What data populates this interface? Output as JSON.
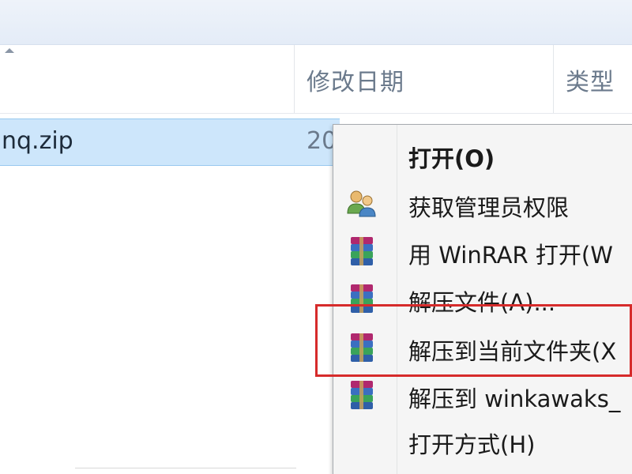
{
  "columns": {
    "date_modified": "修改日期",
    "type": "类型"
  },
  "file": {
    "name": "nq.zip",
    "date_partial": "20"
  },
  "context_menu": {
    "items": [
      {
        "label": "打开(O)",
        "icon": "",
        "bold": true
      },
      {
        "label": "获取管理员权限",
        "icon": "admin-users-icon",
        "bold": false
      },
      {
        "label": "用 WinRAR 打开(W",
        "icon": "winrar-icon",
        "bold": false
      },
      {
        "label": "解压文件(A)...",
        "icon": "winrar-icon",
        "bold": false
      },
      {
        "label": "解压到当前文件夹(X",
        "icon": "winrar-icon",
        "bold": false
      },
      {
        "label": "解压到 winkawaks_",
        "icon": "winrar-icon",
        "bold": false
      },
      {
        "label": "打开方式(H)",
        "icon": "",
        "bold": false
      }
    ]
  },
  "colors": {
    "selection_bg": "#cde6fb",
    "highlight_border": "#d62b2b",
    "menu_bg": "#f5f5f5"
  }
}
